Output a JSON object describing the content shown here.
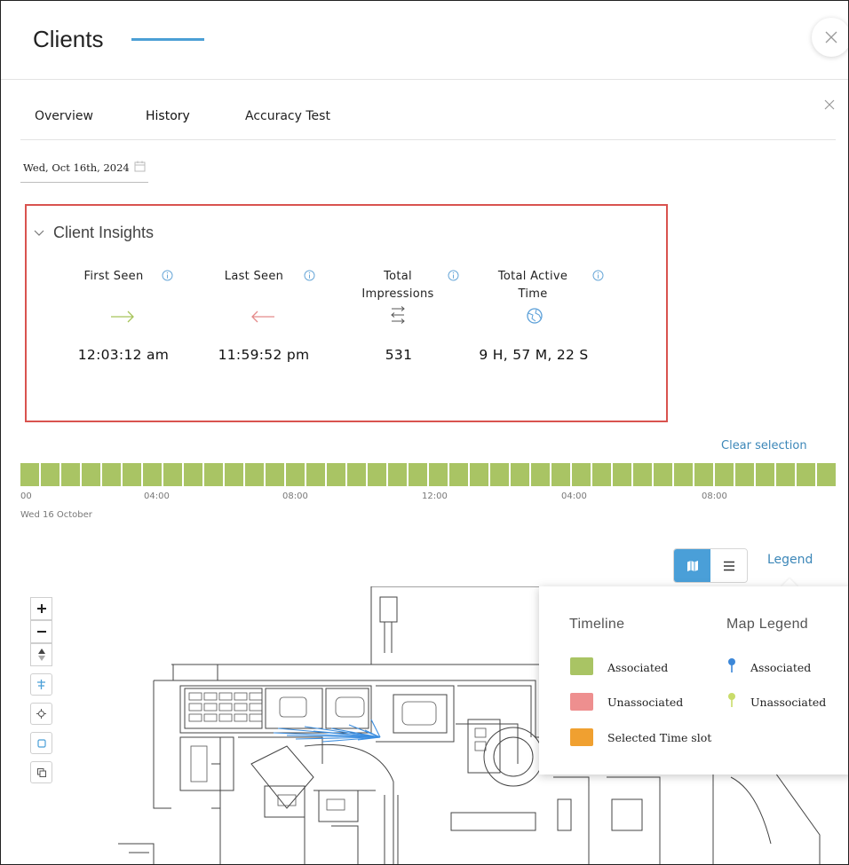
{
  "header": {
    "title": "Clients"
  },
  "tabs": [
    {
      "label": "Overview"
    },
    {
      "label": "History"
    },
    {
      "label": "Accuracy Test"
    }
  ],
  "date_picker": {
    "value": "Wed, Oct 16th, 2024"
  },
  "insights": {
    "title": "Client Insights",
    "metrics": [
      {
        "label": "First Seen",
        "value": "12:03:12 am",
        "icon": "arrow-right-icon"
      },
      {
        "label": "Last Seen",
        "value": "11:59:52 pm",
        "icon": "arrow-left-icon"
      },
      {
        "label": "Total Impressions",
        "value": "531",
        "icon": "exchange-arrows-icon"
      },
      {
        "label": "Total Active Time",
        "value": "9 H, 57 M, 22 S",
        "icon": "globe-icon"
      }
    ]
  },
  "timeline": {
    "clear_label": "Clear selection",
    "ticks": [
      "00",
      "04:00",
      "08:00",
      "12:00",
      "04:00",
      "08:00"
    ],
    "day_label": "Wed 16 October",
    "segment_count": 40
  },
  "map_view": {
    "legend_link": "Legend"
  },
  "legend": {
    "timeline_heading": "Timeline",
    "map_heading": "Map Legend",
    "timeline_items": [
      {
        "label": "Associated",
        "color": "#a9c464"
      },
      {
        "label": "Unassociated",
        "color": "#ee8f8f"
      },
      {
        "label": "Selected Time slot",
        "color": "#f0a030"
      }
    ],
    "map_items": [
      {
        "label": "Associated",
        "color": "#3c87d8"
      },
      {
        "label": "Unassociated",
        "color": "#c9dc6a"
      }
    ]
  },
  "colors": {
    "accent": "#4a9fd8",
    "highlight_border": "#d9534f",
    "timeline_green": "#a9c464"
  }
}
